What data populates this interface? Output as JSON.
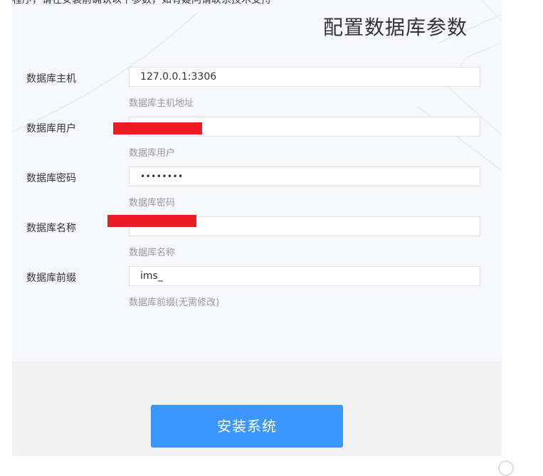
{
  "header": {
    "top_fragment": "程序，请在安装前确认以下参数，如有疑问请联系技术支持",
    "title": "配置数据库参数"
  },
  "fields": [
    {
      "label": "数据库主机",
      "value": "127.0.0.1:3306",
      "hint": "数据库主机地址"
    },
    {
      "label": "数据库用户",
      "value": "",
      "hint": "数据库用户"
    },
    {
      "label": "数据库密码",
      "value": "••••••••",
      "hint": "数据库密码"
    },
    {
      "label": "数据库名称",
      "value": "",
      "hint": "数据库名称"
    },
    {
      "label": "数据库前缀",
      "value": "ims_",
      "hint": "数据库前缀(无需修改)"
    }
  ],
  "footer": {
    "install_label": "安装系统"
  },
  "colors": {
    "accent": "#3a97ff",
    "redaction": "#ed1c24",
    "footer_bg": "#f2f2f2"
  }
}
